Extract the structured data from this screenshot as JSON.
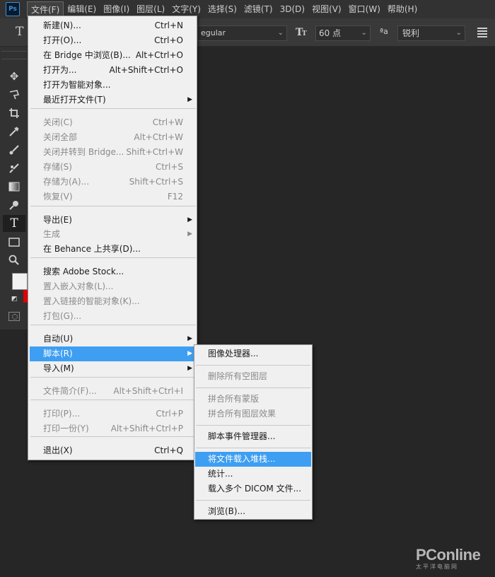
{
  "app": {
    "logo": "Ps"
  },
  "menubar": {
    "items": [
      "文件(F)",
      "编辑(E)",
      "图像(I)",
      "图层(L)",
      "文字(Y)",
      "选择(S)",
      "滤镜(T)",
      "3D(D)",
      "视图(V)",
      "窗口(W)",
      "帮助(H)"
    ],
    "active_index": 0
  },
  "options": {
    "font_style": "egular",
    "font_size": "60 点",
    "antialias": "锐利"
  },
  "tools": [
    "move-icon",
    "lasso-icon",
    "crop-icon",
    "eyedropper-icon",
    "brush-icon",
    "clone-stamp-icon",
    "gradient-icon",
    "dodge-icon",
    "type-icon",
    "rectangle-icon",
    "zoom-icon"
  ],
  "file_menu": {
    "items": [
      {
        "label": "新建(N)...",
        "shortcut": "Ctrl+N",
        "disabled": false
      },
      {
        "label": "打开(O)...",
        "shortcut": "Ctrl+O",
        "disabled": false
      },
      {
        "label": "在 Bridge 中浏览(B)...",
        "shortcut": "Alt+Ctrl+O",
        "disabled": false
      },
      {
        "label": "打开为...",
        "shortcut": "Alt+Shift+Ctrl+O",
        "disabled": false
      },
      {
        "label": "打开为智能对象...",
        "shortcut": "",
        "disabled": false
      },
      {
        "label": "最近打开文件(T)",
        "shortcut": "",
        "disabled": false,
        "submenu": true
      },
      {
        "label": "关闭(C)",
        "shortcut": "Ctrl+W",
        "disabled": true
      },
      {
        "label": "关闭全部",
        "shortcut": "Alt+Ctrl+W",
        "disabled": true
      },
      {
        "label": "关闭并转到 Bridge...",
        "shortcut": "Shift+Ctrl+W",
        "disabled": true
      },
      {
        "label": "存储(S)",
        "shortcut": "Ctrl+S",
        "disabled": true
      },
      {
        "label": "存储为(A)...",
        "shortcut": "Shift+Ctrl+S",
        "disabled": true
      },
      {
        "label": "恢复(V)",
        "shortcut": "F12",
        "disabled": true
      },
      {
        "label": "导出(E)",
        "shortcut": "",
        "disabled": false,
        "submenu": true
      },
      {
        "label": "生成",
        "shortcut": "",
        "disabled": true,
        "submenu": true
      },
      {
        "label": "在 Behance 上共享(D)...",
        "shortcut": "",
        "disabled": false
      },
      {
        "label": "搜索 Adobe Stock...",
        "shortcut": "",
        "disabled": false
      },
      {
        "label": "置入嵌入对象(L)...",
        "shortcut": "",
        "disabled": true
      },
      {
        "label": "置入链接的智能对象(K)...",
        "shortcut": "",
        "disabled": true
      },
      {
        "label": "打包(G)...",
        "shortcut": "",
        "disabled": true
      },
      {
        "label": "自动(U)",
        "shortcut": "",
        "disabled": false,
        "submenu": true
      },
      {
        "label": "脚本(R)",
        "shortcut": "",
        "disabled": false,
        "submenu": true,
        "highlighted": true
      },
      {
        "label": "导入(M)",
        "shortcut": "",
        "disabled": false,
        "submenu": true
      },
      {
        "label": "文件简介(F)...",
        "shortcut": "Alt+Shift+Ctrl+I",
        "disabled": true
      },
      {
        "label": "打印(P)...",
        "shortcut": "Ctrl+P",
        "disabled": true
      },
      {
        "label": "打印一份(Y)",
        "shortcut": "Alt+Shift+Ctrl+P",
        "disabled": true
      },
      {
        "label": "退出(X)",
        "shortcut": "Ctrl+Q",
        "disabled": false
      }
    ]
  },
  "script_menu": {
    "items": [
      {
        "label": "图像处理器...",
        "disabled": false
      },
      {
        "label": "删除所有空图层",
        "disabled": true
      },
      {
        "label": "拼合所有蒙版",
        "disabled": true
      },
      {
        "label": "拼合所有图层效果",
        "disabled": true
      },
      {
        "label": "脚本事件管理器...",
        "disabled": false
      },
      {
        "label": "将文件载入堆栈...",
        "disabled": false,
        "highlighted": true
      },
      {
        "label": "统计...",
        "disabled": false
      },
      {
        "label": "载入多个 DICOM 文件...",
        "disabled": false
      },
      {
        "label": "浏览(B)...",
        "disabled": false
      }
    ]
  },
  "watermark": {
    "main": "PConline",
    "sub": "太平洋电脑网"
  },
  "colors": {
    "highlight": "#3d9ef2",
    "menu_bg": "#f0f0f0",
    "bg_color_swatch": "#e00000"
  }
}
